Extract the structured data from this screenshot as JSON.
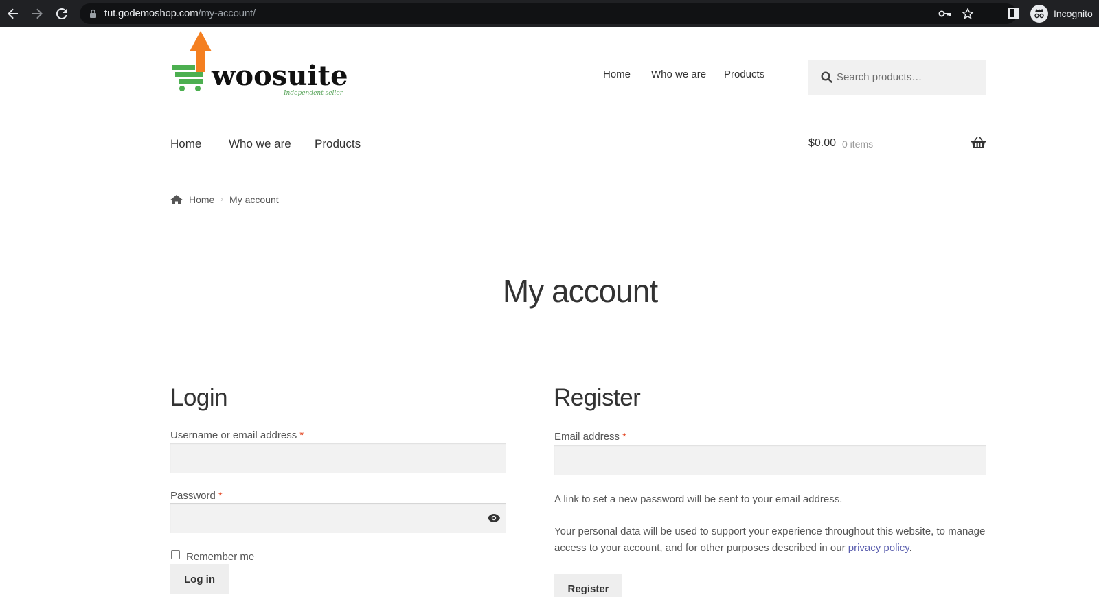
{
  "browser": {
    "url_host": "tut.godemoshop.com",
    "url_path": "/my-account/",
    "profile_label": "Incognito"
  },
  "logo": {
    "name": "woosuite",
    "tagline": "Independent seller",
    "colors": {
      "cart": "#4caf50",
      "arrow": "#f47f20"
    }
  },
  "top_nav": [
    "Home",
    "Who we are",
    "Products"
  ],
  "search": {
    "placeholder": "Search products…"
  },
  "main_nav": [
    "Home",
    "Who we are",
    "Products"
  ],
  "cart": {
    "total": "$0.00",
    "count": "0 items"
  },
  "breadcrumb": {
    "home": "Home",
    "current": "My account"
  },
  "page_title": "My account",
  "login": {
    "title": "Login",
    "username_label": "Username or email address",
    "password_label": "Password",
    "required_mark": "*",
    "remember_label": "Remember me",
    "submit_label": "Log in"
  },
  "register": {
    "title": "Register",
    "email_label": "Email address",
    "required_mark": "*",
    "notice": "A link to set a new password will be sent to your email address.",
    "privacy_text": "Your personal data will be used to support your experience throughout this website, to manage access to your account, and for other purposes described in our",
    "privacy_link": "privacy policy",
    "privacy_end": ".",
    "submit_label": "Register"
  },
  "icons": {
    "back": "arrow-left-icon",
    "forward": "arrow-right-icon",
    "reload": "reload-icon",
    "lock": "lock-icon",
    "key": "key-icon",
    "star": "star-icon",
    "side_panel": "side-panel-icon",
    "incognito": "incognito-icon",
    "search": "search-icon",
    "basket": "basket-icon",
    "home": "home-icon",
    "eye": "eye-icon"
  }
}
